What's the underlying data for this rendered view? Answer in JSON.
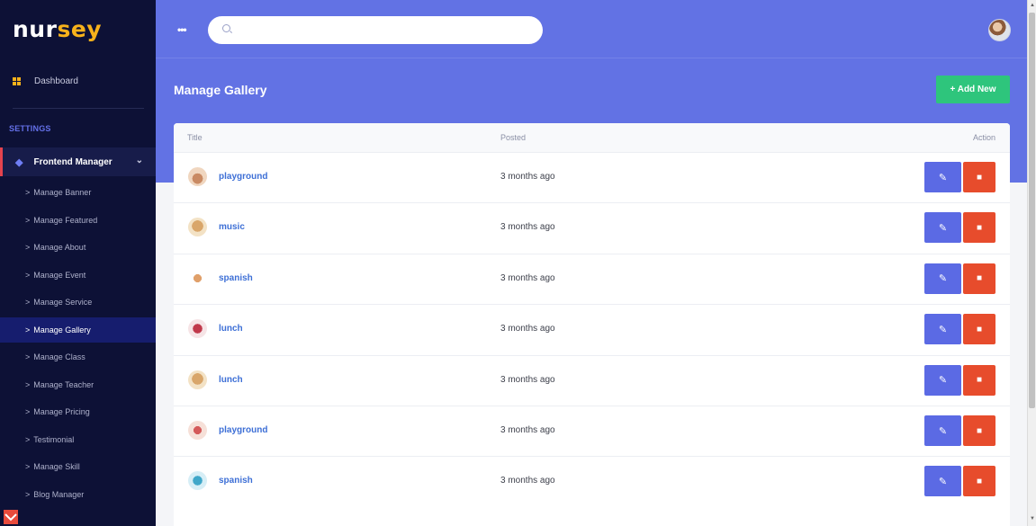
{
  "brand": {
    "prefix": "nur",
    "accent": "sey"
  },
  "sidebar": {
    "dashboard": "Dashboard",
    "settings_heading": "SETTINGS",
    "frontend_manager": "Frontend Manager",
    "items": [
      {
        "label": "Manage Banner",
        "active": false
      },
      {
        "label": "Manage Featured",
        "active": false
      },
      {
        "label": "Manage About",
        "active": false
      },
      {
        "label": "Manage Event",
        "active": false
      },
      {
        "label": "Manage Service",
        "active": false
      },
      {
        "label": "Manage Gallery",
        "active": true
      },
      {
        "label": "Manage Class",
        "active": false
      },
      {
        "label": "Manage Teacher",
        "active": false
      },
      {
        "label": "Manage Pricing",
        "active": false
      },
      {
        "label": "Testimonial",
        "active": false
      },
      {
        "label": "Manage Skill",
        "active": false
      },
      {
        "label": "Blog Manager",
        "active": false
      }
    ]
  },
  "search": {
    "placeholder": ""
  },
  "header": {
    "title": "Manage Gallery",
    "add_label": "+ Add New"
  },
  "table": {
    "columns": {
      "title": "Title",
      "posted": "Posted",
      "action": "Action"
    },
    "rows": [
      {
        "title": "playground",
        "posted": "3 months ago"
      },
      {
        "title": "music",
        "posted": "3 months ago"
      },
      {
        "title": "spanish",
        "posted": "3 months ago"
      },
      {
        "title": "lunch",
        "posted": "3 months ago"
      },
      {
        "title": "lunch",
        "posted": "3 months ago"
      },
      {
        "title": "playground",
        "posted": "3 months ago"
      },
      {
        "title": "spanish",
        "posted": "3 months ago"
      }
    ]
  },
  "colors": {
    "sidebar_bg": "#0d1136",
    "header_bg": "#6272e4",
    "add_button": "#2ec57c",
    "edit_button": "#5b6ae4",
    "delete_button": "#e74c2c",
    "link_text": "#3d6fd6"
  },
  "icons": {
    "dashboard": "grid-icon",
    "frontend": "diamond-icon",
    "edit": "pencil-icon",
    "delete": "trash-icon",
    "menu": "ellipsis-icon",
    "search": "search-icon"
  }
}
